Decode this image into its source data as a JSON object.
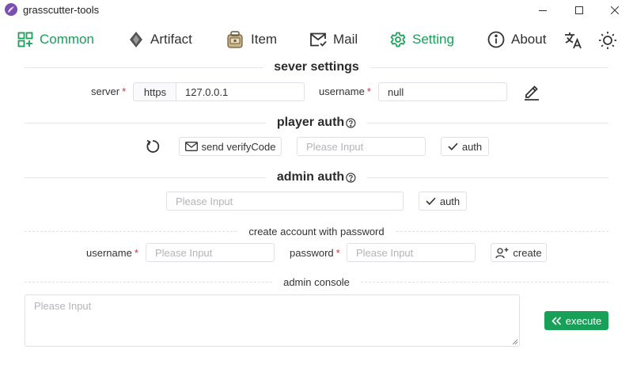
{
  "window": {
    "title": "grasscutter-tools"
  },
  "nav": {
    "items": [
      {
        "label": "Common",
        "icon": "grid-plus-icon",
        "active": true
      },
      {
        "label": "Artifact",
        "icon": "artifact-icon",
        "active": false
      },
      {
        "label": "Item",
        "icon": "backpack-icon",
        "active": false
      },
      {
        "label": "Mail",
        "icon": "mail-icon",
        "active": false
      },
      {
        "label": "Setting",
        "icon": "gear-icon",
        "active": true
      },
      {
        "label": "About",
        "icon": "info-icon",
        "active": false
      }
    ],
    "language_icon": "translate-icon",
    "theme_icon": "sun-icon",
    "accent_color": "#18a058"
  },
  "server_settings": {
    "heading": "sever settings",
    "server_label": "server",
    "protocol": "https",
    "server_value": "127.0.0.1",
    "username_label": "username",
    "username_value": "null"
  },
  "player_auth": {
    "heading": "player auth",
    "send_button": "send verifyCode",
    "code_placeholder": "Please Input",
    "auth_button": "auth"
  },
  "admin_auth": {
    "heading": "admin auth",
    "input_placeholder": "Please Input",
    "auth_button": "auth"
  },
  "create_account": {
    "heading": "create account with password",
    "username_label": "username",
    "username_placeholder": "Please Input",
    "password_label": "password",
    "password_placeholder": "Please Input",
    "create_button": "create"
  },
  "admin_console": {
    "heading": "admin console",
    "placeholder": "Please Input",
    "execute_button": "execute"
  },
  "required_mark": "*"
}
